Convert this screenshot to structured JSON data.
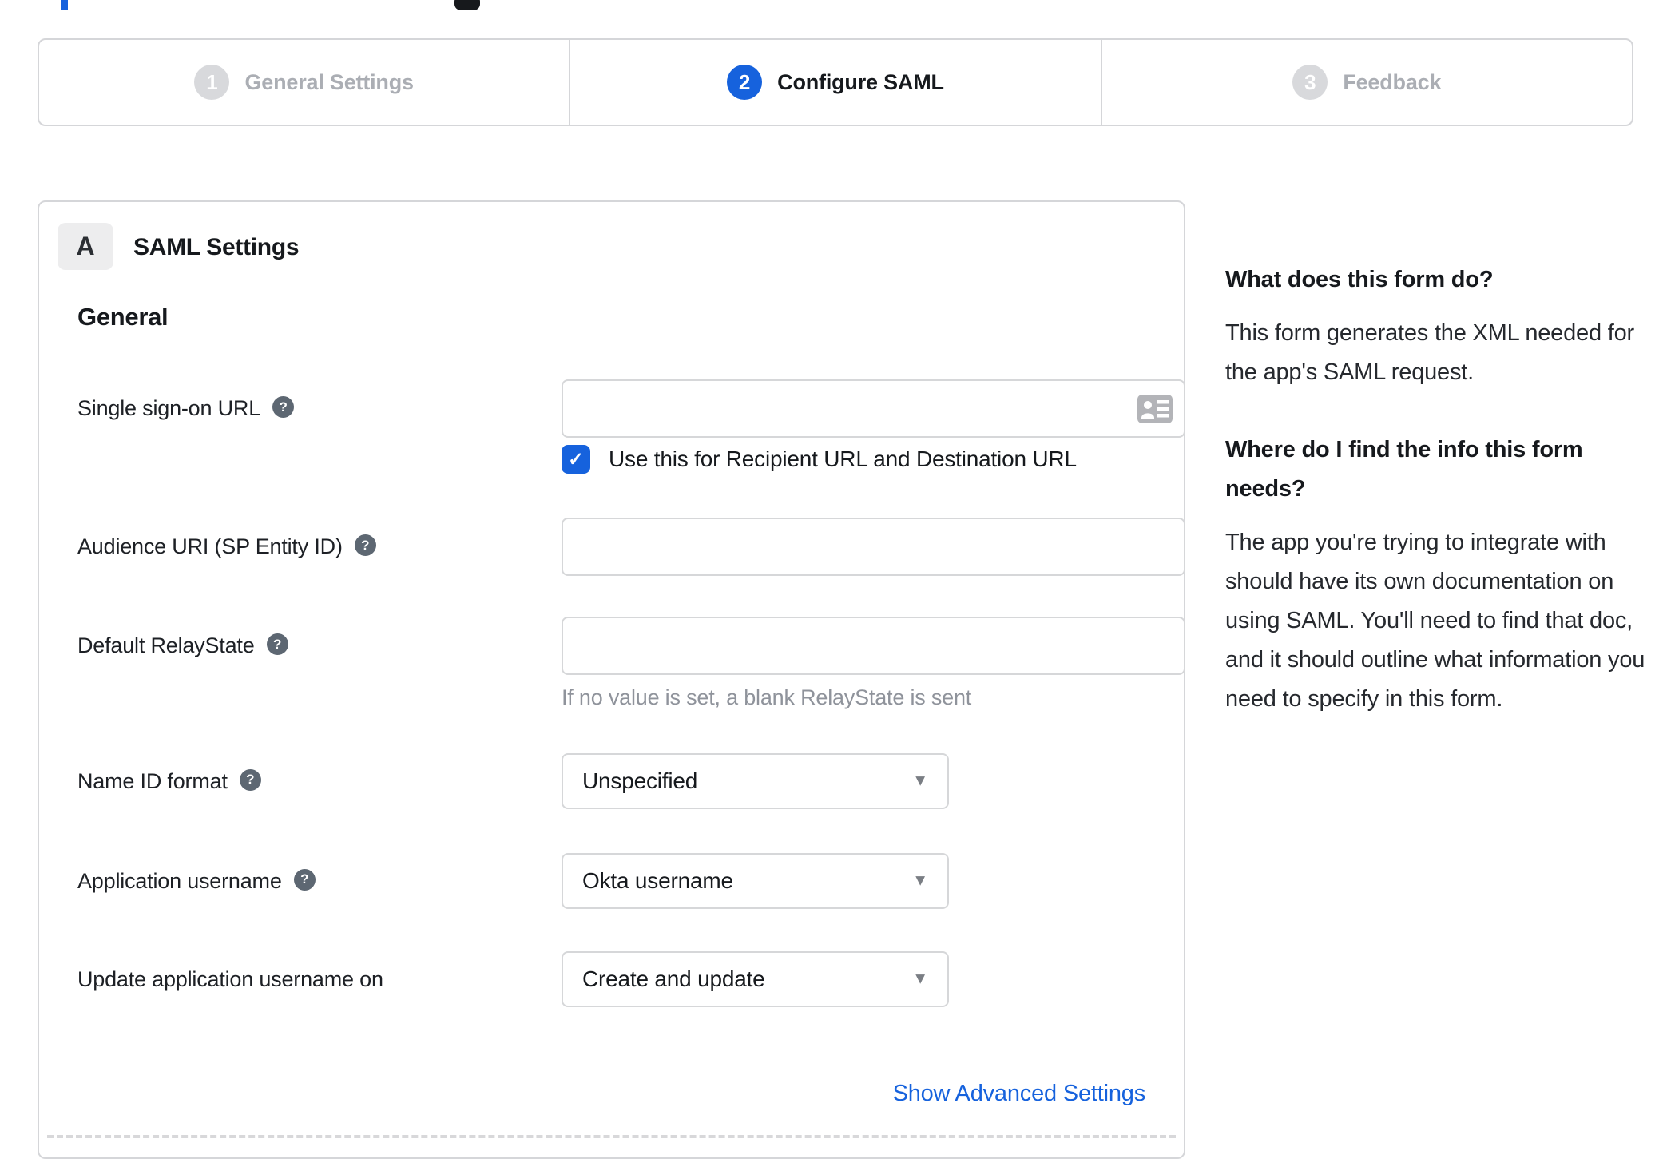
{
  "colors": {
    "accent_blue": "#1662dd",
    "inactive_gray": "#abaeb4",
    "border_gray": "#d5d6d9",
    "help_icon_gray": "#5d6772",
    "hint_gray": "#8f939b"
  },
  "icons": {
    "check": "✓",
    "dropdown_arrow": "▼",
    "help": "?"
  },
  "stepper": {
    "steps": [
      {
        "number": "1",
        "label": "General Settings",
        "state": "inactive"
      },
      {
        "number": "2",
        "label": "Configure SAML",
        "state": "active"
      },
      {
        "number": "3",
        "label": "Feedback",
        "state": "inactive"
      }
    ]
  },
  "saml_card": {
    "badge": "A",
    "title": "SAML Settings",
    "group_heading": "General",
    "fields": [
      {
        "label": "Single sign-on URL",
        "value": "",
        "checkbox_label": "Use this for Recipient URL and Destination URL",
        "checkbox_checked": true
      },
      {
        "label": "Audience URI (SP Entity ID)",
        "value": ""
      },
      {
        "label": "Default RelayState",
        "value": "",
        "hint": "If no value is set, a blank RelayState is sent"
      },
      {
        "label": "Name ID format",
        "value": "Unspecified"
      },
      {
        "label": "Application username",
        "value": "Okta username"
      },
      {
        "label": "Update application username on",
        "value": "Create and update"
      }
    ],
    "advanced_link": "Show Advanced Settings"
  },
  "sidebar": {
    "blocks": [
      {
        "heading": "What does this form do?",
        "body": "This form generates the XML needed for the app's SAML request."
      },
      {
        "heading": "Where do I find the info this form needs?",
        "body": "The app you're trying to integrate with should have its own documentation on using SAML. You'll need to find that doc, and it should outline what information you need to specify in this form."
      }
    ]
  }
}
